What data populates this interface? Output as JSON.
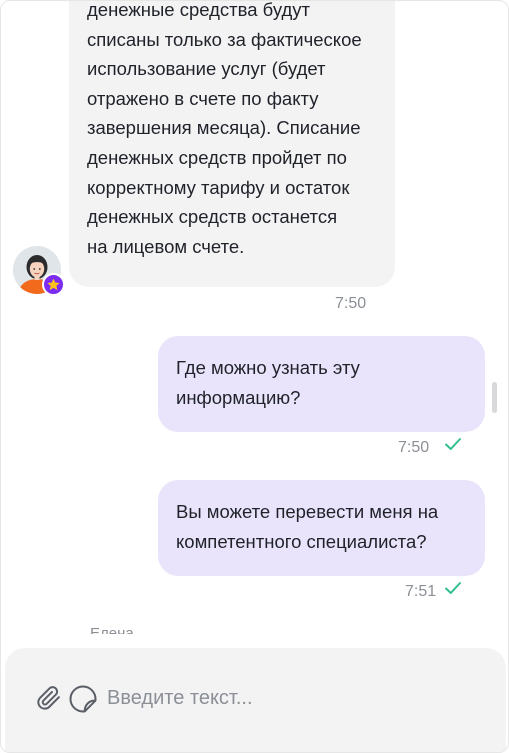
{
  "messages": [
    {
      "direction": "incoming",
      "lines": [
        "денежные средства будут",
        "списаны только за фактическое",
        "использование услуг (будет",
        "отражено в счете по факту",
        "завершения месяца). Списание",
        "денежных средств пройдет по",
        "корректному тарифу и остаток",
        "денежных средств останется",
        "на лицевом счете."
      ],
      "time": "7:50"
    },
    {
      "direction": "outgoing",
      "lines": [
        "Где можно узнать эту",
        "информацию?"
      ],
      "time": "7:50",
      "read": true
    },
    {
      "direction": "outgoing",
      "lines": [
        "Вы можете перевести меня на",
        "компетентного специалиста?"
      ],
      "time": "7:51",
      "read": true
    }
  ],
  "partial_sender": "Елена",
  "composer": {
    "placeholder": "Введите текст...",
    "value": ""
  },
  "icons": {
    "attach": "paperclip-icon",
    "sticker": "sticker-icon",
    "read": "check-icon",
    "badge": "star-icon"
  },
  "colors": {
    "incoming_bubble": "#f3f3f4",
    "outgoing_bubble": "#e9e4fb",
    "read_check": "#2fbf8f",
    "badge": "#7b2cf0",
    "badge_star": "#ffc21a",
    "timestamp": "#8b8f96"
  }
}
